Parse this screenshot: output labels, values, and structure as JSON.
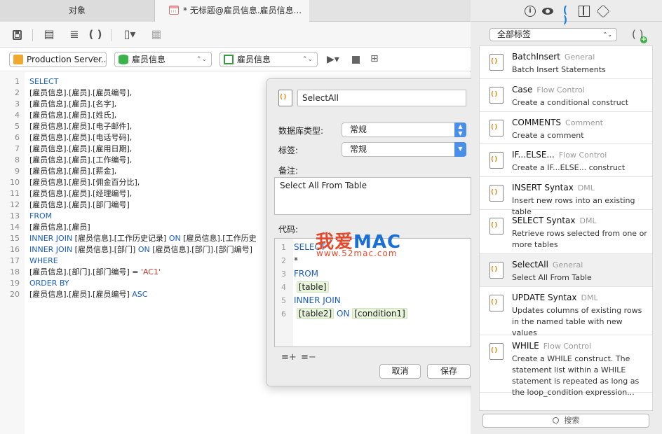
{
  "tabs": {
    "objects": "对象",
    "query": "* 无标题@雇员信息.雇员信息..."
  },
  "selectors": {
    "connection": "Production Server...",
    "database": "雇员信息",
    "schema": "雇员信息"
  },
  "editor_lines": [
    {
      "n": "1",
      "parts": [
        {
          "t": "SELECT",
          "k": "kw"
        }
      ]
    },
    {
      "n": "2",
      "parts": [
        {
          "t": "[雇员信息].[雇员].[雇员编号],",
          "k": ""
        }
      ]
    },
    {
      "n": "3",
      "parts": [
        {
          "t": "[雇员信息].[雇员].[名字],",
          "k": ""
        }
      ]
    },
    {
      "n": "4",
      "parts": [
        {
          "t": "[雇员信息].[雇员].[姓氏],",
          "k": ""
        }
      ]
    },
    {
      "n": "5",
      "parts": [
        {
          "t": "[雇员信息].[雇员].[电子邮件],",
          "k": ""
        }
      ]
    },
    {
      "n": "6",
      "parts": [
        {
          "t": "[雇员信息].[雇员].[电话号码],",
          "k": ""
        }
      ]
    },
    {
      "n": "7",
      "parts": [
        {
          "t": "[雇员信息].[雇员].[雇用日期],",
          "k": ""
        }
      ]
    },
    {
      "n": "8",
      "parts": [
        {
          "t": "[雇员信息].[雇员].[工作编号],",
          "k": ""
        }
      ]
    },
    {
      "n": "9",
      "parts": [
        {
          "t": "[雇员信息].[雇员].[薪金],",
          "k": ""
        }
      ]
    },
    {
      "n": "10",
      "parts": [
        {
          "t": "[雇员信息].[雇员].[佣金百分比],",
          "k": ""
        }
      ]
    },
    {
      "n": "11",
      "parts": [
        {
          "t": "[雇员信息].[雇员].[经理编号],",
          "k": ""
        }
      ]
    },
    {
      "n": "12",
      "parts": [
        {
          "t": "[雇员信息].[雇员].[部门编号]",
          "k": ""
        }
      ]
    },
    {
      "n": "13",
      "parts": [
        {
          "t": "FROM",
          "k": "kw"
        }
      ]
    },
    {
      "n": "14",
      "parts": [
        {
          "t": "[雇员信息].[雇员]",
          "k": ""
        }
      ]
    },
    {
      "n": "15",
      "parts": [
        {
          "t": "INNER JOIN",
          "k": "kw"
        },
        {
          "t": " [雇员信息].[工作历史记录] ",
          "k": ""
        },
        {
          "t": "ON",
          "k": "kw"
        },
        {
          "t": " [雇员信息].[工作历史",
          "k": ""
        }
      ]
    },
    {
      "n": "16",
      "parts": [
        {
          "t": "INNER JOIN",
          "k": "kw"
        },
        {
          "t": " [雇员信息].[部门] ",
          "k": ""
        },
        {
          "t": "ON",
          "k": "kw"
        },
        {
          "t": " [雇员信息].[部门].[部门编号]",
          "k": ""
        }
      ]
    },
    {
      "n": "17",
      "parts": [
        {
          "t": "WHERE",
          "k": "kw"
        }
      ]
    },
    {
      "n": "18",
      "parts": [
        {
          "t": "[雇员信息].[部门].[部门编号] = ",
          "k": ""
        },
        {
          "t": "'AC1'",
          "k": "str"
        }
      ]
    },
    {
      "n": "19",
      "parts": [
        {
          "t": "ORDER BY",
          "k": "kw"
        }
      ]
    },
    {
      "n": "20",
      "parts": [
        {
          "t": "[雇员信息].[雇员].[雇员编号] ",
          "k": ""
        },
        {
          "t": "ASC",
          "k": "kw"
        }
      ]
    }
  ],
  "popover": {
    "name": "SelectAll",
    "db_type_label": "数据库类型:",
    "db_type_value": "常规",
    "tag_label": "标签:",
    "tag_value": "常规",
    "remark_label": "备注:",
    "remark_value": "Select All From Table",
    "code_label": "代码:",
    "code_lines": [
      {
        "n": "1",
        "parts": [
          {
            "t": "SELECT",
            "k": "kw"
          }
        ]
      },
      {
        "n": "2",
        "parts": [
          {
            "t": "*",
            "k": ""
          }
        ]
      },
      {
        "n": "3",
        "parts": [
          {
            "t": "FROM",
            "k": "kw"
          }
        ]
      },
      {
        "n": "4",
        "parts": [
          {
            "t": " ",
            "k": ""
          },
          {
            "t": "[table]",
            "k": "ph"
          }
        ]
      },
      {
        "n": "5",
        "parts": [
          {
            "t": "INNER JOIN",
            "k": "kw"
          }
        ]
      },
      {
        "n": "6",
        "parts": [
          {
            "t": " ",
            "k": ""
          },
          {
            "t": "[table2]",
            "k": "ph"
          },
          {
            "t": " ",
            "k": ""
          },
          {
            "t": "ON",
            "k": "kw"
          },
          {
            "t": " ",
            "k": ""
          },
          {
            "t": "[condition1]",
            "k": "ph"
          }
        ]
      }
    ],
    "cancel": "取消",
    "save": "保存"
  },
  "watermark": {
    "love": "我爱",
    "mac": "MAC",
    "url": "www.52mac.com"
  },
  "right_panel": {
    "filter": "全部标签",
    "search_placeholder": "搜索",
    "items": [
      {
        "title": "BatchInsert",
        "category": "General",
        "desc": "Batch Insert Statements"
      },
      {
        "title": "Case",
        "category": "Flow Control",
        "desc": "Create a conditional construct"
      },
      {
        "title": "COMMENTS",
        "category": "Comment",
        "desc": "Create a comment"
      },
      {
        "title": "IF...ELSE...",
        "category": "Flow Control",
        "desc": "Create a IF...ELSE... construct"
      },
      {
        "title": "INSERT Syntax",
        "category": "DML",
        "desc": "Insert new rows into an existing table"
      },
      {
        "title": "SELECT Syntax",
        "category": "DML",
        "desc": "Retrieve rows selected from one or more tables"
      },
      {
        "title": "SelectAll",
        "category": "General",
        "desc": "Select All From Table"
      },
      {
        "title": "UPDATE Syntax",
        "category": "DML",
        "desc": "Updates columns of existing rows in the named table with new values"
      },
      {
        "title": "WHILE",
        "category": "Flow Control",
        "desc": "Create a WHILE construct. The statement list within a WHILE statement is repeated as long as the loop_condition expression..."
      }
    ]
  }
}
